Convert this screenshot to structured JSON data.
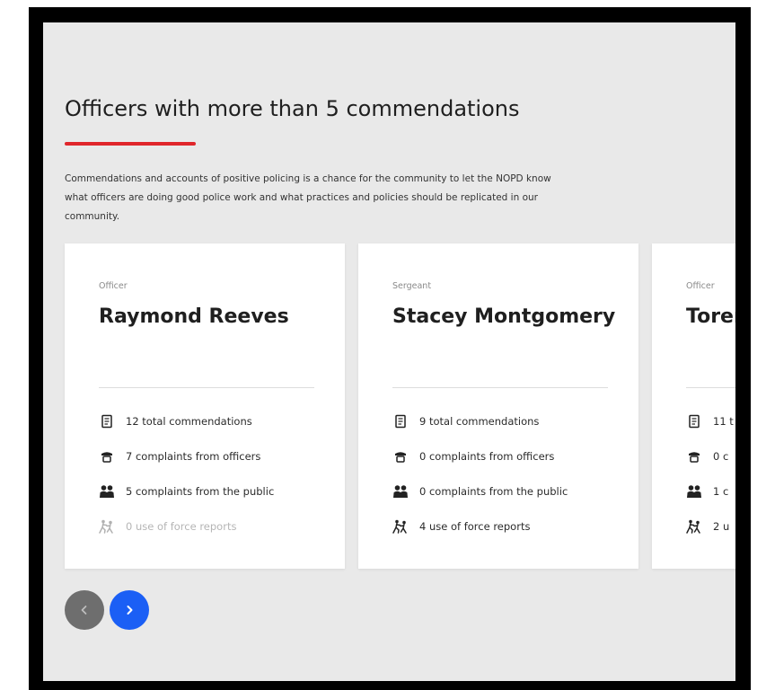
{
  "section": {
    "title": "Officers with more than 5 commendations",
    "description": "Commendations and accounts of positive policing is a chance for the community to let the NOPD know what officers are doing good police work and what practices and policies should be replicated in our community."
  },
  "cards": [
    {
      "rank": "Officer",
      "name": "Raymond Reeves",
      "commendations": "12 total commendations",
      "officer_complaints": "7 complaints from officers",
      "public_complaints": "5 complaints from the public",
      "force_reports": "0 use of force reports"
    },
    {
      "rank": "Sergeant",
      "name": "Stacey Montgomery",
      "commendations": "9 total commendations",
      "officer_complaints": "0 complaints from officers",
      "public_complaints": "0 complaints from the public",
      "force_reports": "4 use of force reports"
    },
    {
      "rank": "Officer",
      "name": "Torer",
      "commendations": "11 t",
      "officer_complaints": "0 c",
      "public_complaints": "1 c",
      "force_reports": "2 u"
    }
  ],
  "stat_icons": [
    "document-icon",
    "officer-cap-icon",
    "people-icon",
    "use-of-force-icon"
  ],
  "nav": {
    "prev_icon": "chevron-left-icon",
    "next_icon": "chevron-right-icon"
  },
  "colors": {
    "accent_red": "#e0262b",
    "nav_next_blue": "#1b5ff5",
    "nav_prev_gray": "#6e6e6e",
    "panel_background": "#e9e9e9",
    "card_background": "#ffffff"
  }
}
